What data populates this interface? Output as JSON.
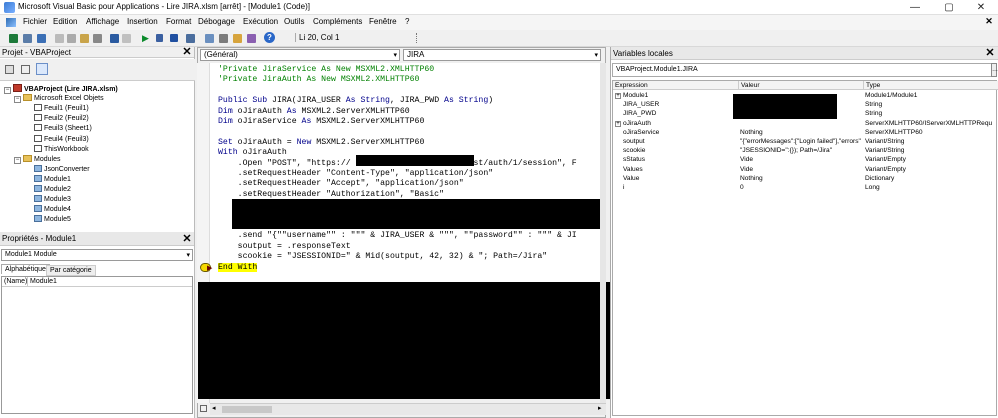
{
  "window": {
    "title": "Microsoft Visual Basic pour Applications - Lire JIRA.xlsm [arrêt] - [Module1 (Code)]",
    "minimize": "—",
    "restore": "▢",
    "close": "✕"
  },
  "menu": {
    "items": [
      "Fichier",
      "Edition",
      "Affichage",
      "Insertion",
      "Format",
      "Débogage",
      "Exécution",
      "Outils",
      "Compléments",
      "Fenêtre",
      "?"
    ]
  },
  "toolbar": {
    "position": "Li 20, Col 1"
  },
  "project": {
    "title": "Projet - VBAProject",
    "tree": [
      {
        "label": "VBAProject (Lire JIRA.xlsm)",
        "level": 0,
        "kind": "vba",
        "bold": true
      },
      {
        "label": "Microsoft Excel Objets",
        "level": 1,
        "kind": "folder"
      },
      {
        "label": "Feuil1 (Feuil1)",
        "level": 2,
        "kind": "sheet"
      },
      {
        "label": "Feuil2 (Feuil2)",
        "level": 2,
        "kind": "sheet"
      },
      {
        "label": "Feuil3 (Sheet1)",
        "level": 2,
        "kind": "sheet"
      },
      {
        "label": "Feuil4 (Feuil3)",
        "level": 2,
        "kind": "sheet"
      },
      {
        "label": "ThisWorkbook",
        "level": 2,
        "kind": "sheet"
      },
      {
        "label": "Modules",
        "level": 1,
        "kind": "folder"
      },
      {
        "label": "JsonConverter",
        "level": 2,
        "kind": "module"
      },
      {
        "label": "Module1",
        "level": 2,
        "kind": "module"
      },
      {
        "label": "Module2",
        "level": 2,
        "kind": "module"
      },
      {
        "label": "Module3",
        "level": 2,
        "kind": "module"
      },
      {
        "label": "Module4",
        "level": 2,
        "kind": "module"
      },
      {
        "label": "Module5",
        "level": 2,
        "kind": "module"
      }
    ]
  },
  "properties": {
    "title": "Propriétés - Module1",
    "object": "Module1  Module",
    "tab_alpha": "Alphabétique",
    "tab_cat": "Par catégorie",
    "name_key": "(Name)",
    "name_val": "Module1"
  },
  "editor": {
    "object_combo": "(Général)",
    "proc_combo": "JIRA",
    "lines": [
      {
        "parts": [
          [
            "cm",
            "'Private JiraService As New MSXML2.XMLHTTP60"
          ]
        ]
      },
      {
        "parts": [
          [
            "cm",
            "'Private JiraAuth As New MSXML2.XMLHTTP60"
          ]
        ]
      },
      {
        "parts": []
      },
      {
        "parts": [
          [
            "kw",
            "Public Sub "
          ],
          [
            "",
            "JIRA(JIRA_USER "
          ],
          [
            "kw",
            "As String"
          ],
          [
            "",
            ", JIRA_PWD "
          ],
          [
            "kw",
            "As String"
          ],
          [
            "",
            ")"
          ]
        ]
      },
      {
        "parts": [
          [
            "kw",
            "Dim "
          ],
          [
            "",
            "oJiraAuth "
          ],
          [
            "kw",
            "As "
          ],
          [
            "",
            "MSXML2.ServerXMLHTTP60"
          ]
        ]
      },
      {
        "parts": [
          [
            "kw",
            "Dim "
          ],
          [
            "",
            "oJiraService "
          ],
          [
            "kw",
            "As "
          ],
          [
            "",
            "MSXML2.ServerXMLHTTP60"
          ]
        ]
      },
      {
        "parts": []
      },
      {
        "parts": [
          [
            "kw",
            "Set "
          ],
          [
            "",
            "oJiraAuth = "
          ],
          [
            "kw",
            "New "
          ],
          [
            "",
            "MSXML2.ServerXMLHTTP60"
          ]
        ]
      },
      {
        "parts": [
          [
            "kw",
            "With "
          ],
          [
            "",
            "oJiraAuth"
          ]
        ]
      },
      {
        "parts": [
          [
            "",
            "    .Open \"POST\", \"https://                      /rest/auth/1/session\", F"
          ]
        ]
      },
      {
        "parts": [
          [
            "",
            "    .setRequestHeader \"Content-Type\", \"application/json\""
          ]
        ]
      },
      {
        "parts": [
          [
            "",
            "    .setRequestHeader \"Accept\", \"application/json\""
          ]
        ]
      },
      {
        "parts": [
          [
            "",
            "    .setRequestHeader \"Authorization\", \"Basic\""
          ]
        ]
      },
      {
        "parts": []
      },
      {
        "parts": []
      },
      {
        "parts": []
      },
      {
        "parts": [
          [
            "",
            "    .send \"{\"\"username\"\" : \"\"\" & JIRA_USER & \"\"\", \"\"password\"\" : \"\"\" & JI"
          ]
        ]
      },
      {
        "parts": [
          [
            "",
            "    soutput = .responseText"
          ]
        ]
      },
      {
        "parts": [
          [
            "",
            "    scookie = \"JSESSIONID=\" & Mid(soutput, 42, 32) & \"; Path=/Jira\""
          ]
        ]
      },
      {
        "parts": [
          [
            "hl",
            "End With"
          ]
        ]
      }
    ]
  },
  "locals": {
    "title": "Variables locales",
    "context": "VBAProject.Module1.JIRA",
    "headers": [
      "Expression",
      "Valeur",
      "Type"
    ],
    "rows": [
      {
        "exp": "Module1",
        "val": "",
        "type": "Module1/Module1",
        "expand": "+"
      },
      {
        "exp": "JIRA_USER",
        "val": "",
        "type": "String"
      },
      {
        "exp": "JIRA_PWD",
        "val": "",
        "type": "String"
      },
      {
        "exp": "oJiraAuth",
        "val": "",
        "type": "ServerXMLHTTP60/IServerXMLHTTPRequ",
        "expand": "+"
      },
      {
        "exp": "oJiraService",
        "val": "Nothing",
        "type": "ServerXMLHTTP60"
      },
      {
        "exp": "soutput",
        "val": "\"{\"errorMessages\":[\"Login failed\"],\"errors\"",
        "type": "Variant/String"
      },
      {
        "exp": "scookie",
        "val": "\"JSESSIONID=\":{}); Path=/Jira\"",
        "type": "Variant/String"
      },
      {
        "exp": "sStatus",
        "val": "Vide",
        "type": "Variant/Empty"
      },
      {
        "exp": "Values",
        "val": "Vide",
        "type": "Variant/Empty"
      },
      {
        "exp": "Value",
        "val": "Nothing",
        "type": "Dictionary"
      },
      {
        "exp": "i",
        "val": "0",
        "type": "Long"
      }
    ]
  },
  "colors": {
    "keyword": "#00008b",
    "comment": "#008000",
    "highlight": "#ffff00",
    "redaction": "#000000"
  }
}
